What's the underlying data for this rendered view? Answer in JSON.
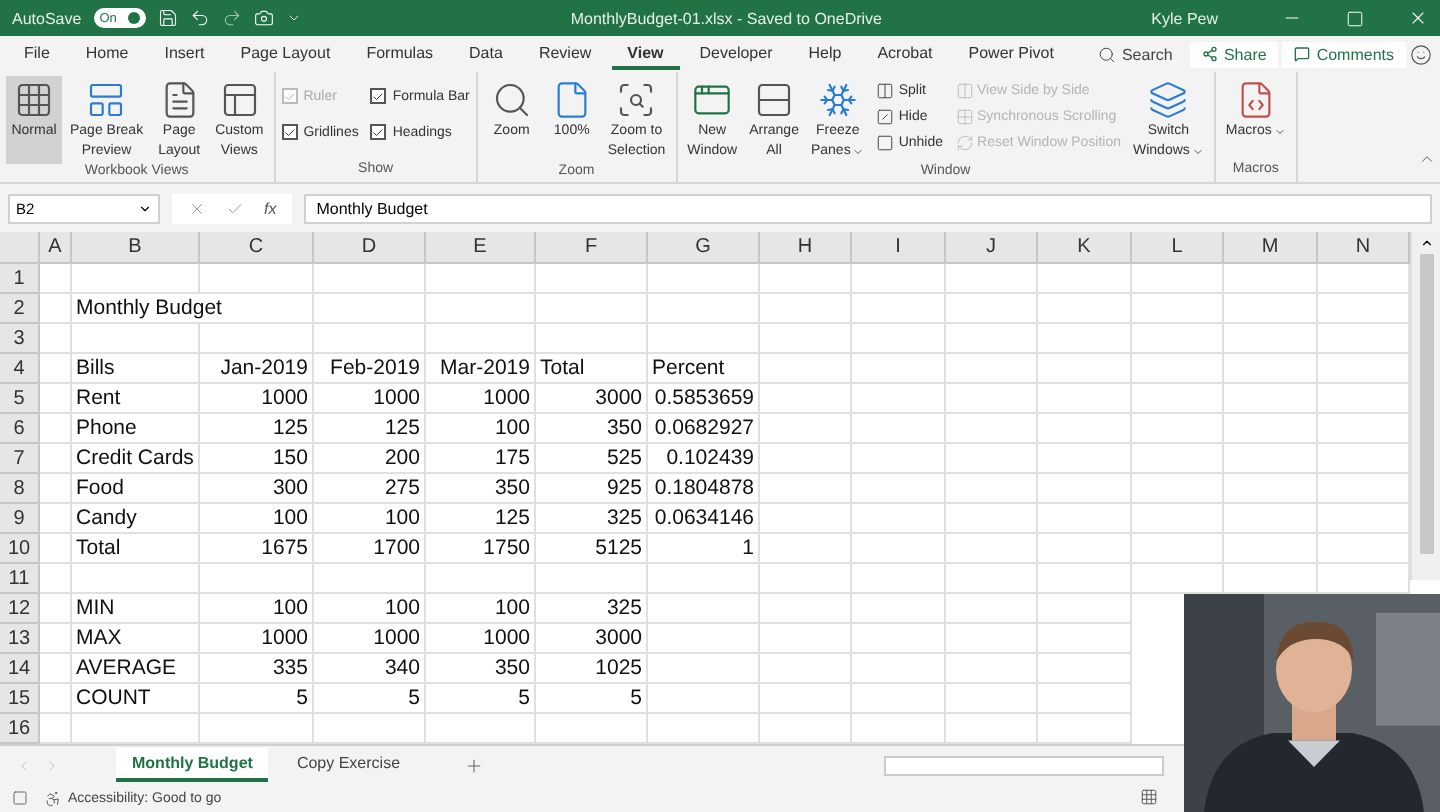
{
  "title_bar": {
    "autosave_label": "AutoSave",
    "autosave_toggle": {
      "label": "On",
      "on": true
    },
    "title": "MonthlyBudget-01.xlsx  -  Saved to OneDrive",
    "user": "Kyle Pew"
  },
  "menu_tabs": [
    {
      "label": "File",
      "selected": false
    },
    {
      "label": "Home",
      "selected": false
    },
    {
      "label": "Insert",
      "selected": false
    },
    {
      "label": "Page Layout",
      "selected": false
    },
    {
      "label": "Formulas",
      "selected": false
    },
    {
      "label": "Data",
      "selected": false
    },
    {
      "label": "Review",
      "selected": false
    },
    {
      "label": "View",
      "selected": true
    },
    {
      "label": "Developer",
      "selected": false
    },
    {
      "label": "Help",
      "selected": false
    },
    {
      "label": "Acrobat",
      "selected": false
    },
    {
      "label": "Power Pivot",
      "selected": false
    }
  ],
  "search": {
    "placeholder": "Search"
  },
  "share_button": "Share",
  "comments_button": "Comments",
  "ribbon": [
    {
      "label": "Workbook Views",
      "items": [
        {
          "kind": "large",
          "lines": [
            "Normal"
          ],
          "selected": true
        },
        {
          "kind": "large",
          "lines": [
            "Page Break",
            "Preview"
          ],
          "selected": false
        },
        {
          "kind": "large",
          "lines": [
            "Page",
            "Layout"
          ],
          "selected": false
        },
        {
          "kind": "large",
          "lines": [
            "Custom",
            "Views"
          ],
          "selected": false
        }
      ]
    },
    {
      "label": "Show",
      "items": [
        {
          "kind": "check",
          "label": "Ruler",
          "checked": true,
          "disabled": true
        },
        {
          "kind": "check",
          "label": "Gridlines",
          "checked": true,
          "disabled": false
        },
        {
          "kind": "check",
          "label": "Formula Bar",
          "checked": true,
          "disabled": false
        },
        {
          "kind": "check",
          "label": "Headings",
          "checked": true,
          "disabled": false
        }
      ]
    },
    {
      "label": "Zoom",
      "items": [
        {
          "kind": "large",
          "lines": [
            "Zoom"
          ]
        },
        {
          "kind": "large",
          "lines": [
            "100%"
          ]
        },
        {
          "kind": "large",
          "lines": [
            "Zoom to",
            "Selection"
          ]
        }
      ]
    },
    {
      "label": "Window",
      "items": [
        {
          "kind": "large",
          "lines": [
            "New",
            "Window"
          ]
        },
        {
          "kind": "large",
          "lines": [
            "Arrange",
            "All"
          ]
        },
        {
          "kind": "large",
          "lines": [
            "Freeze",
            "Panes"
          ],
          "dropdown": true
        },
        {
          "kind": "small",
          "label": "Split",
          "disabled": false
        },
        {
          "kind": "small",
          "label": "Hide",
          "disabled": false
        },
        {
          "kind": "small",
          "label": "Unhide",
          "disabled": false
        },
        {
          "kind": "small",
          "label": "View Side by Side",
          "disabled": true
        },
        {
          "kind": "small",
          "label": "Synchronous Scrolling",
          "disabled": true
        },
        {
          "kind": "small",
          "label": "Reset Window Position",
          "disabled": true
        },
        {
          "kind": "large",
          "lines": [
            "Switch",
            "Windows"
          ],
          "dropdown": true
        }
      ]
    },
    {
      "label": "Macros",
      "items": [
        {
          "kind": "large",
          "lines": [
            "Macros"
          ],
          "dropdown": true
        }
      ]
    }
  ],
  "formula_bar": {
    "name_box": "B2",
    "fx_label": "fx",
    "value": "Monthly Budget"
  },
  "sheet": {
    "columns": [
      "A",
      "B",
      "C",
      "D",
      "E",
      "F",
      "G",
      "H",
      "I",
      "J",
      "K",
      "L",
      "M",
      "N"
    ],
    "rows": [
      {
        "number": "1",
        "cells": []
      },
      {
        "number": "2",
        "cells": [
          {},
          {
            "value": "Monthly Budget",
            "kind": "text"
          }
        ]
      },
      {
        "number": "3",
        "cells": []
      },
      {
        "number": "4",
        "cells": [
          {},
          {
            "value": "Bills",
            "kind": "text"
          },
          {
            "value": "Jan-2019",
            "kind": "number"
          },
          {
            "value": "Feb-2019",
            "kind": "number"
          },
          {
            "value": "Mar-2019",
            "kind": "number"
          },
          {
            "value": "Total",
            "kind": "text"
          },
          {
            "value": "Percent",
            "kind": "text"
          }
        ]
      },
      {
        "number": "5",
        "cells": [
          {},
          {
            "value": "Rent",
            "kind": "text"
          },
          {
            "value": "1000",
            "kind": "number"
          },
          {
            "value": "1000",
            "kind": "number"
          },
          {
            "value": "1000",
            "kind": "number"
          },
          {
            "value": "3000",
            "kind": "number"
          },
          {
            "value": "0.5853659",
            "kind": "number"
          }
        ]
      },
      {
        "number": "6",
        "cells": [
          {},
          {
            "value": "Phone",
            "kind": "text"
          },
          {
            "value": "125",
            "kind": "number"
          },
          {
            "value": "125",
            "kind": "number"
          },
          {
            "value": "100",
            "kind": "number"
          },
          {
            "value": "350",
            "kind": "number"
          },
          {
            "value": "0.0682927",
            "kind": "number"
          }
        ]
      },
      {
        "number": "7",
        "cells": [
          {},
          {
            "value": "Credit Cards",
            "kind": "text"
          },
          {
            "value": "150",
            "kind": "number"
          },
          {
            "value": "200",
            "kind": "number"
          },
          {
            "value": "175",
            "kind": "number"
          },
          {
            "value": "525",
            "kind": "number"
          },
          {
            "value": "0.102439",
            "kind": "number"
          }
        ]
      },
      {
        "number": "8",
        "cells": [
          {},
          {
            "value": "Food",
            "kind": "text"
          },
          {
            "value": "300",
            "kind": "number"
          },
          {
            "value": "275",
            "kind": "number"
          },
          {
            "value": "350",
            "kind": "number"
          },
          {
            "value": "925",
            "kind": "number"
          },
          {
            "value": "0.1804878",
            "kind": "number"
          }
        ]
      },
      {
        "number": "9",
        "cells": [
          {},
          {
            "value": "Candy",
            "kind": "text"
          },
          {
            "value": "100",
            "kind": "number"
          },
          {
            "value": "100",
            "kind": "number"
          },
          {
            "value": "125",
            "kind": "number"
          },
          {
            "value": "325",
            "kind": "number"
          },
          {
            "value": "0.0634146",
            "kind": "number"
          }
        ]
      },
      {
        "number": "10",
        "cells": [
          {},
          {
            "value": "Total",
            "kind": "text"
          },
          {
            "value": "1675",
            "kind": "number"
          },
          {
            "value": "1700",
            "kind": "number"
          },
          {
            "value": "1750",
            "kind": "number"
          },
          {
            "value": "5125",
            "kind": "number"
          },
          {
            "value": "1",
            "kind": "number"
          }
        ]
      },
      {
        "number": "11",
        "cells": []
      },
      {
        "number": "12",
        "cells": [
          {},
          {
            "value": "MIN",
            "kind": "text"
          },
          {
            "value": "100",
            "kind": "number"
          },
          {
            "value": "100",
            "kind": "number"
          },
          {
            "value": "100",
            "kind": "number"
          },
          {
            "value": "325",
            "kind": "number"
          }
        ]
      },
      {
        "number": "13",
        "cells": [
          {},
          {
            "value": "MAX",
            "kind": "text"
          },
          {
            "value": "1000",
            "kind": "number"
          },
          {
            "value": "1000",
            "kind": "number"
          },
          {
            "value": "1000",
            "kind": "number"
          },
          {
            "value": "3000",
            "kind": "number"
          }
        ]
      },
      {
        "number": "14",
        "cells": [
          {},
          {
            "value": "AVERAGE",
            "kind": "text"
          },
          {
            "value": "335",
            "kind": "number"
          },
          {
            "value": "340",
            "kind": "number"
          },
          {
            "value": "350",
            "kind": "number"
          },
          {
            "value": "1025",
            "kind": "number"
          }
        ]
      },
      {
        "number": "15",
        "cells": [
          {},
          {
            "value": "COUNT",
            "kind": "text"
          },
          {
            "value": "5",
            "kind": "number"
          },
          {
            "value": "5",
            "kind": "number"
          },
          {
            "value": "5",
            "kind": "number"
          },
          {
            "value": "5",
            "kind": "number"
          }
        ]
      },
      {
        "number": "16",
        "cells": []
      }
    ]
  },
  "sheet_tabs": [
    {
      "label": "Monthly Budget",
      "selected": true
    },
    {
      "label": "Copy Exercise",
      "selected": false
    }
  ],
  "status_bar": {
    "accessibility": "Accessibility: Good to go"
  }
}
